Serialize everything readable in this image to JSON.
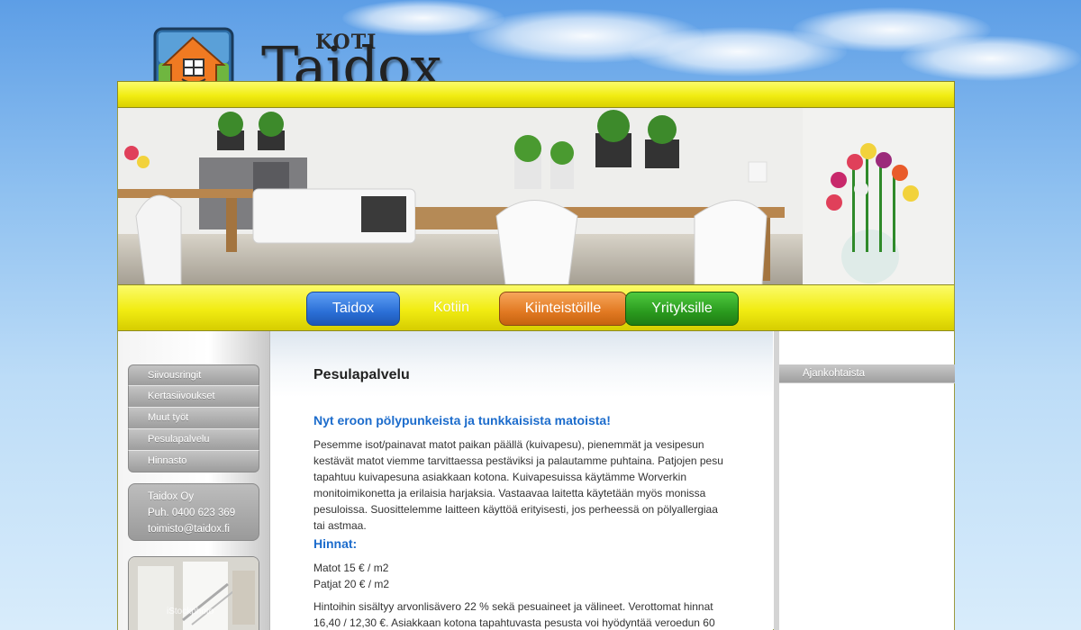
{
  "brand": {
    "koti": "KOTI",
    "name": "Taidox"
  },
  "nav": {
    "items": [
      {
        "label": "Taidox",
        "color": "#2b6fd6"
      },
      {
        "label": "Kotiin",
        "color": ""
      },
      {
        "label": "Kiinteistöille",
        "color": "#e17922"
      },
      {
        "label": "Yrityksille",
        "color": "#2a9a1e"
      }
    ]
  },
  "sidebar": {
    "items": [
      {
        "label": "Siivousringit"
      },
      {
        "label": "Kertasiivoukset"
      },
      {
        "label": "Muut työt"
      },
      {
        "label": "Pesulapalvelu"
      },
      {
        "label": "Hinnasto"
      }
    ],
    "contact": {
      "company": "Taidox Oy",
      "phone": "Puh. 0400 623 369",
      "email": "toimisto@taidox.fi"
    },
    "photo_watermark": "iStockphoto"
  },
  "main": {
    "title": "Pesulapalvelu",
    "subheading": "Nyt eroon pölypunkeista ja tunkkaisista matoista!",
    "paragraph1": "Pesemme isot/painavat matot paikan päällä (kuivapesu), pienemmät ja vesipesun kestävät matot viemme tarvittaessa pestäviksi ja palautamme puhtaina. Patjojen pesu tapahtuu kuivapesuna asiakkaan kotona. Kuivapesuissa käytämme Worverkin monitoimikonetta ja erilaisia harjaksia. Vastaavaa laitetta käytetään myös monissa pesuloissa. Suosittelemme laitteen käyttöä erityisesti, jos perheessä on pölyallergiaa tai astmaa.",
    "prices_heading": "Hinnat:",
    "price_lines": [
      "Matot 15 € / m2",
      "Patjat 20 € / m2"
    ],
    "paragraph2": "Hintoihin sisältyy arvonlisävero 22 % sekä pesuaineet ja välineet. Verottomat hinnat 16,40 / 12,30 €. Asiakkaan kotona tapahtuvasta pesusta voi hyödyntää veroedun 60"
  },
  "right": {
    "tab_label": "Ajankohtaista"
  }
}
